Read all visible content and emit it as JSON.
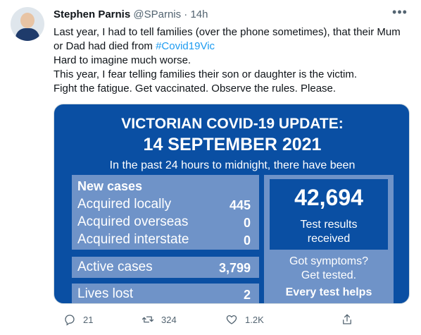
{
  "tweet": {
    "author_name": "Stephen Parnis",
    "author_handle": "@SParnis",
    "separator": "·",
    "time": "14h",
    "more_icon": "more-horizontal-icon",
    "text_lines": [
      "Last year, I had to tell families (over the phone sometimes), that their Mum",
      "or Dad had died from ",
      "Hard to imagine much worse.",
      "This year, I fear telling families their son or daughter is the victim.",
      "Fight the fatigue. Get vaccinated. Observe the rules. Please."
    ],
    "hashtag": "#Covid19Vic",
    "hashtag_color": "#1d9bf0"
  },
  "media": {
    "title_line1": "VICTORIAN COVID-19 UPDATE:",
    "title_line2": "14 SEPTEMBER 2021",
    "subtitle": "In the past 24 hours to midnight, there have been",
    "new_cases_heading": "New cases",
    "rows": [
      {
        "label": "Acquired locally",
        "value": "445"
      },
      {
        "label": "Acquired overseas",
        "value": "0"
      },
      {
        "label": "Acquired interstate",
        "value": "0"
      }
    ],
    "active_label": "Active cases",
    "active_value": "3,799",
    "lives_label": "Lives lost",
    "lives_value": "2",
    "tests_value": "42,694",
    "tests_label1": "Test results",
    "tests_label2": "received",
    "symptoms1": "Got symptoms?",
    "symptoms2": "Get tested.",
    "symptoms3": "Every test helps",
    "bg_color": "#0a4fa3",
    "panel_color": "#6f93c8"
  },
  "actions": {
    "reply_count": "21",
    "retweet_count": "324",
    "like_count": "1.2K",
    "reply_icon": "reply-icon",
    "retweet_icon": "retweet-icon",
    "like_icon": "heart-icon",
    "share_icon": "share-icon"
  }
}
